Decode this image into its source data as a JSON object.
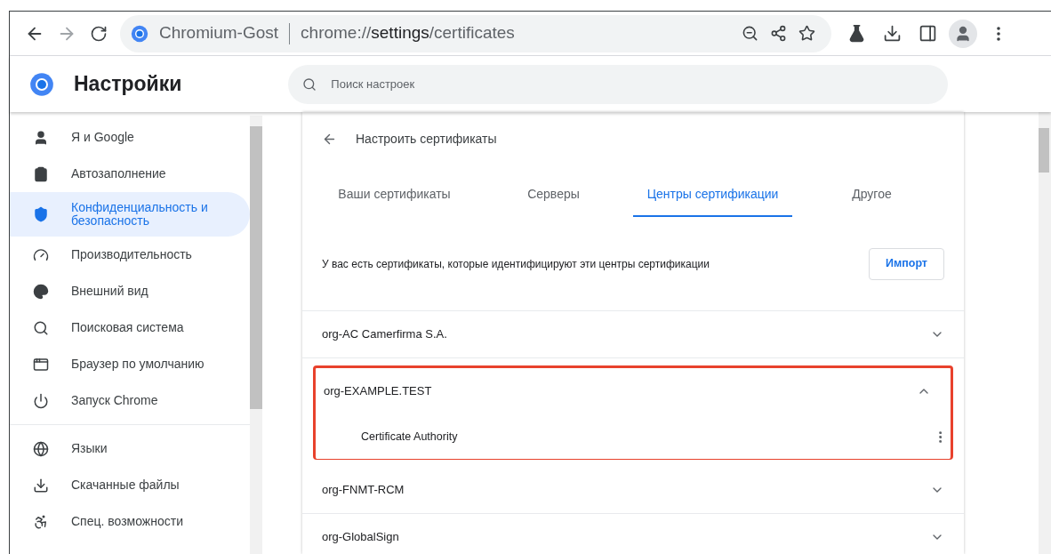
{
  "toolbar": {
    "site_name": "Chromium-Gost",
    "url": {
      "scheme": "chrome://",
      "host": "settings",
      "path": "/certificates"
    }
  },
  "header": {
    "title": "Настройки",
    "search": {
      "placeholder": "Поиск настроек"
    }
  },
  "sidebar": {
    "sections": [
      [
        {
          "label": "Я и Google",
          "selected": false
        },
        {
          "label": "Автозаполнение",
          "selected": false
        },
        {
          "label": "Конфиденциальность и безопасность",
          "selected": true
        },
        {
          "label": "Производительность",
          "selected": false
        },
        {
          "label": "Внешний вид",
          "selected": false
        },
        {
          "label": "Поисковая система",
          "selected": false
        },
        {
          "label": "Браузер по умолчанию",
          "selected": false
        },
        {
          "label": "Запуск Chrome",
          "selected": false
        }
      ],
      [
        {
          "label": "Языки",
          "selected": false
        },
        {
          "label": "Скачанные файлы",
          "selected": false
        },
        {
          "label": "Спец. возможности",
          "selected": false
        }
      ]
    ]
  },
  "page": {
    "back_title": "Настроить сертификаты",
    "tabs": [
      {
        "label": "Ваши сертификаты",
        "selected": false
      },
      {
        "label": "Серверы",
        "selected": false
      },
      {
        "label": "Центры сертификации",
        "selected": true
      },
      {
        "label": "Другое",
        "selected": false
      }
    ],
    "description": "У вас есть сертификаты, которые идентифицируют эти центры сертификации",
    "import_button": "Импорт",
    "authorities": [
      {
        "name": "org-AC Camerfirma S.A.",
        "expanded": false,
        "highlighted": false
      },
      {
        "name": "org-EXAMPLE.TEST",
        "expanded": true,
        "highlighted": true,
        "children": [
          {
            "name": "Certificate Authority"
          }
        ]
      },
      {
        "name": "org-FNMT-RCM",
        "expanded": false,
        "highlighted": false
      },
      {
        "name": "org-GlobalSign",
        "expanded": false,
        "highlighted": false
      }
    ]
  }
}
